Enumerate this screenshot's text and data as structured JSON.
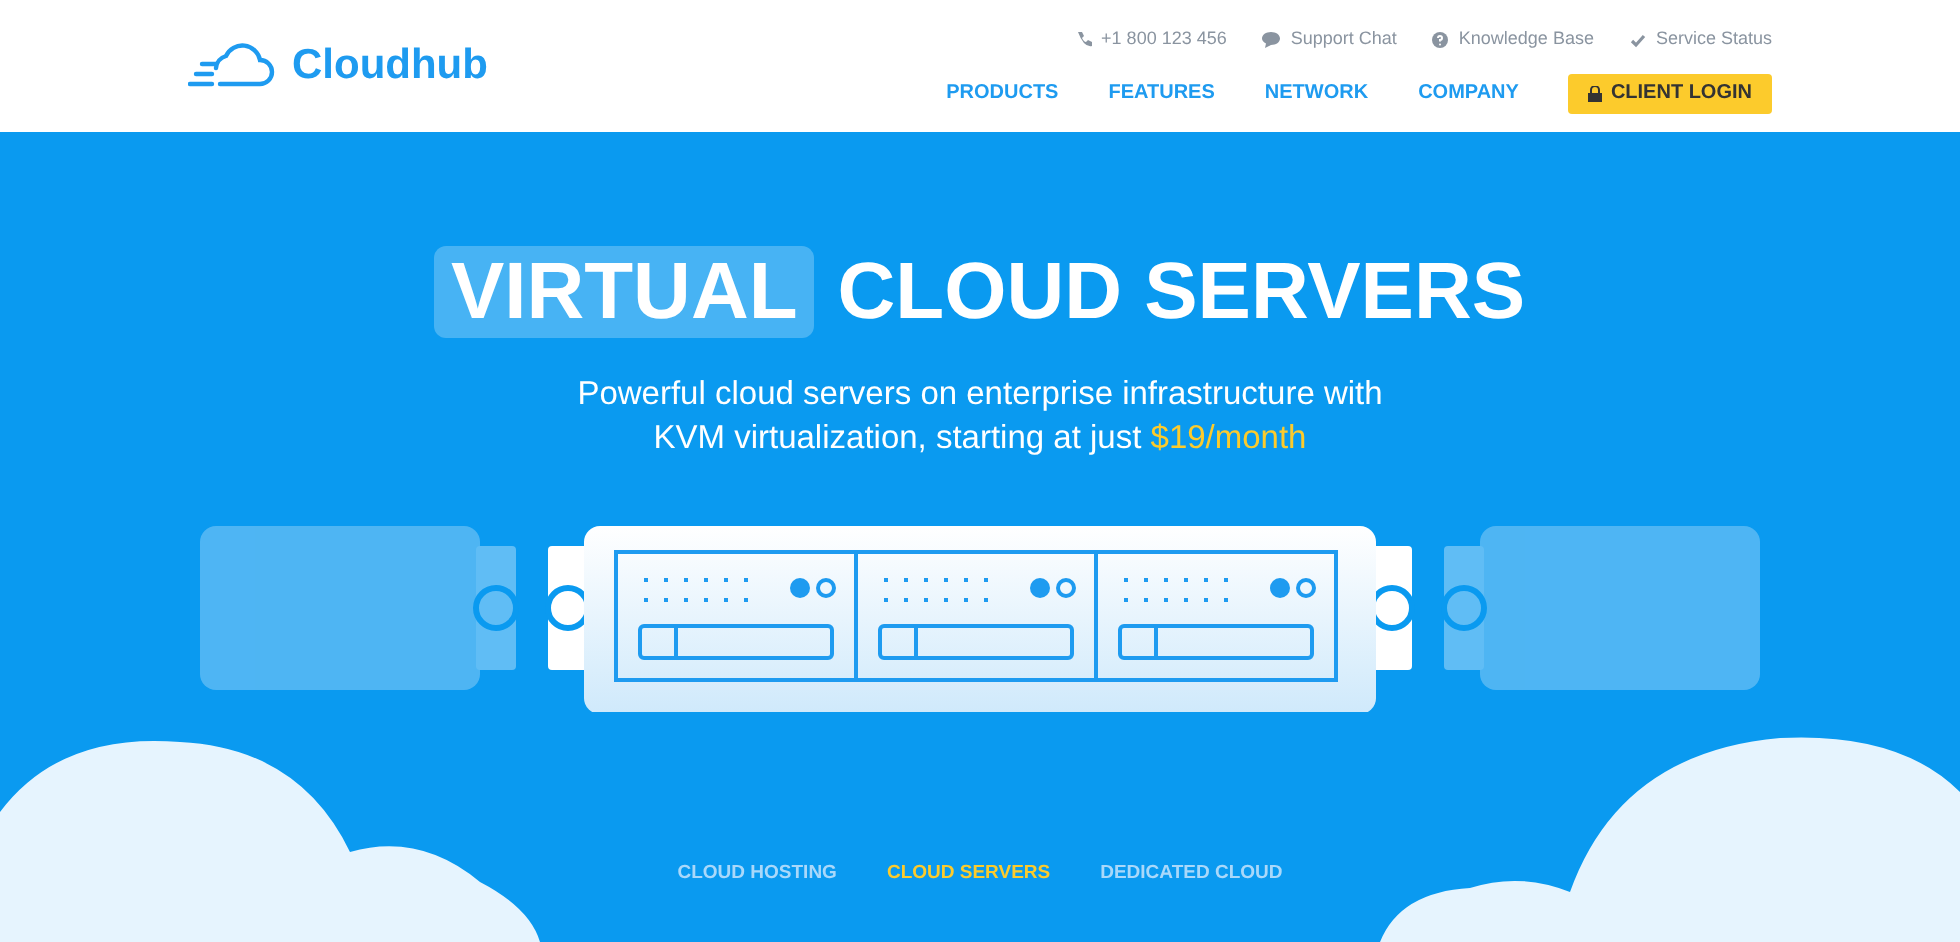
{
  "logo": {
    "text": "Cloudhub"
  },
  "top_links": [
    {
      "kind": "phone",
      "label": "+1 800 123 456"
    },
    {
      "kind": "chat",
      "label": "Support Chat"
    },
    {
      "kind": "help",
      "label": "Knowledge Base"
    },
    {
      "kind": "check",
      "label": "Service Status"
    }
  ],
  "nav": [
    {
      "label": "PRODUCTS"
    },
    {
      "label": "FEATURES"
    },
    {
      "label": "NETWORK"
    },
    {
      "label": "COMPANY"
    }
  ],
  "login_button": {
    "label": "CLIENT LOGIN"
  },
  "hero": {
    "highlight": "VIRTUAL",
    "title": "CLOUD SERVERS",
    "subtitle": "Powerful cloud servers on enterprise infrastructure with KVM virtualization, starting at just",
    "price": "$19/month"
  },
  "tabs": [
    {
      "label": "CLOUD HOSTING",
      "selected": false
    },
    {
      "label": "CLOUD SERVERS",
      "selected": true
    },
    {
      "label": "DEDICATED CLOUD",
      "selected": false
    }
  ]
}
